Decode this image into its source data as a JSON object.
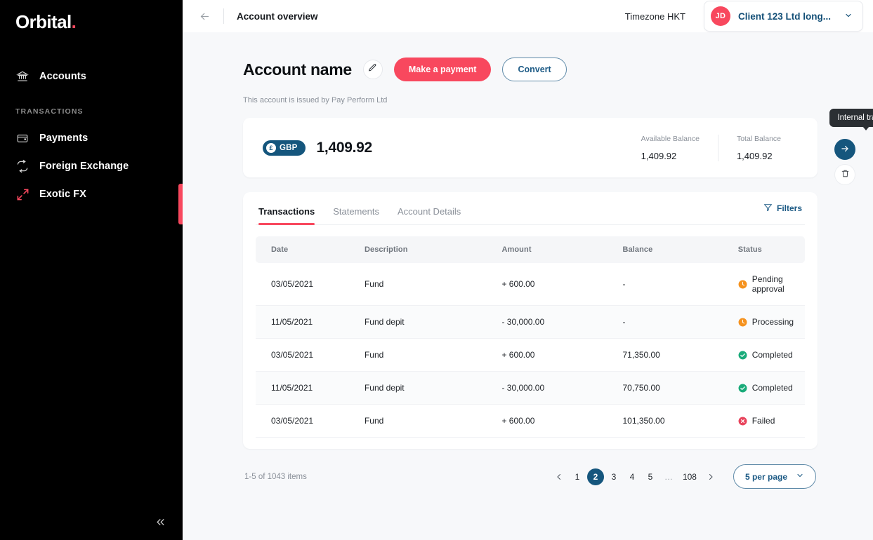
{
  "sidebar": {
    "brand": "Orbital",
    "brand_dot": ".",
    "items": [
      {
        "label": "Accounts",
        "icon": "bank-icon"
      }
    ],
    "section_label": "TRANSACTIONS",
    "transaction_items": [
      {
        "label": "Payments",
        "icon": "wallet-icon"
      },
      {
        "label": "Foreign Exchange",
        "icon": "exchange-icon"
      },
      {
        "label": "Exotic FX",
        "icon": "exotic-fx-icon"
      }
    ],
    "collapse_icon": "chevrons-left-icon"
  },
  "topbar": {
    "back_icon": "arrow-left-icon",
    "title": "Account overview",
    "timezone": "Timezone HKT",
    "client": {
      "initials": "JD",
      "name": "Client 123 Ltd long...",
      "chevron": "chevron-down-icon"
    }
  },
  "account": {
    "name": "Account name",
    "edit_icon": "pencil-icon",
    "make_payment_label": "Make a payment",
    "convert_label": "Convert",
    "issued_by": "This account is issued by Pay Perform Ltd"
  },
  "balance": {
    "currency_symbol": "£",
    "currency_code": "GBP",
    "amount": "1,409.92",
    "available_label": "Available Balance",
    "available_value": "1,409.92",
    "total_label": "Total Balance",
    "total_value": "1,409.92",
    "tooltip": "Internal transfer",
    "transfer_icon": "arrow-right-icon",
    "delete_icon": "trash-icon"
  },
  "tabs": [
    {
      "label": "Transactions",
      "active": true
    },
    {
      "label": "Statements",
      "active": false
    },
    {
      "label": "Account Details",
      "active": false
    }
  ],
  "filters": {
    "label": "Filters",
    "icon": "filter-icon"
  },
  "table": {
    "columns": [
      "Date",
      "Description",
      "Amount",
      "Balance",
      "Status"
    ],
    "rows": [
      {
        "date": "03/05/2021",
        "description": "Fund",
        "amount": "+ 600.00",
        "balance": "-",
        "status": "Pending approval",
        "status_type": "pending"
      },
      {
        "date": "11/05/2021",
        "description": "Fund depit",
        "amount": "- 30,000.00",
        "balance": "-",
        "status": "Processing",
        "status_type": "pending"
      },
      {
        "date": "03/05/2021",
        "description": "Fund",
        "amount": "+ 600.00",
        "balance": "71,350.00",
        "status": "Completed",
        "status_type": "completed"
      },
      {
        "date": "11/05/2021",
        "description": "Fund depit",
        "amount": "- 30,000.00",
        "balance": "70,750.00",
        "status": "Completed",
        "status_type": "completed"
      },
      {
        "date": "03/05/2021",
        "description": "Fund",
        "amount": "+ 600.00",
        "balance": "101,350.00",
        "status": "Failed",
        "status_type": "failed"
      }
    ]
  },
  "pagination": {
    "info": "1-5 of 1043 items",
    "prev_icon": "chevron-left-icon",
    "next_icon": "chevron-right-icon",
    "pages": [
      "1",
      "2",
      "3",
      "4",
      "5",
      "…",
      "108"
    ],
    "active_page": "2",
    "per_page_label": "5 per page",
    "per_page_chevron": "chevron-down-icon"
  },
  "colors": {
    "brand_red": "#f8485e",
    "deep_blue": "#15567d",
    "link_blue": "#1c5a85",
    "green": "#1aab7a",
    "orange": "#f5921e",
    "red_status": "#e8445c"
  }
}
